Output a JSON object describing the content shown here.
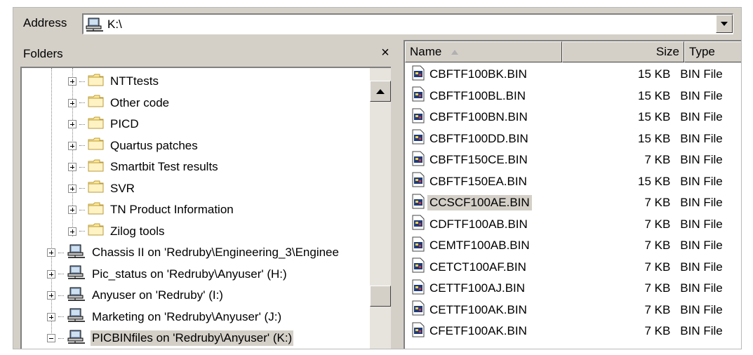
{
  "address": {
    "label": "Address",
    "path": "K:\\"
  },
  "folders": {
    "title": "Folders",
    "close_glyph": "×",
    "items": [
      {
        "label": "NTTtests",
        "icon": "folder-icon",
        "level": 2
      },
      {
        "label": "Other code",
        "icon": "folder-icon",
        "level": 2
      },
      {
        "label": "PICD",
        "icon": "folder-icon",
        "level": 2
      },
      {
        "label": "Quartus patches",
        "icon": "folder-icon",
        "level": 2
      },
      {
        "label": "Smartbit Test results",
        "icon": "folder-icon",
        "level": 2
      },
      {
        "label": "SVR",
        "icon": "folder-icon",
        "level": 2
      },
      {
        "label": "TN Product Information",
        "icon": "folder-icon",
        "level": 2
      },
      {
        "label": "Zilog tools",
        "icon": "folder-icon",
        "level": 2
      },
      {
        "label": "Chassis II on 'Redruby\\Engineering_3\\Enginee",
        "icon": "network-drive-icon",
        "level": 1
      },
      {
        "label": "Pic_status on 'Redruby\\Anyuser' (H:)",
        "icon": "network-drive-icon",
        "level": 1
      },
      {
        "label": "Anyuser on 'Redruby' (I:)",
        "icon": "network-drive-icon",
        "level": 1
      },
      {
        "label": "Marketing on 'Redruby\\Anyuser' (J:)",
        "icon": "network-drive-icon",
        "level": 1
      },
      {
        "label": "PICBINfiles on 'Redruby\\Anyuser' (K:)",
        "icon": "network-drive-icon",
        "level": 1,
        "selected": true,
        "expanded": true
      }
    ]
  },
  "files": {
    "columns": {
      "name": "Name",
      "size": "Size",
      "type": "Type"
    },
    "rows": [
      {
        "name": "CBFTF100BK.BIN",
        "size": "15 KB",
        "type": "BIN File"
      },
      {
        "name": "CBFTF100BL.BIN",
        "size": "15 KB",
        "type": "BIN File"
      },
      {
        "name": "CBFTF100BN.BIN",
        "size": "15 KB",
        "type": "BIN File"
      },
      {
        "name": "CBFTF100DD.BIN",
        "size": "15 KB",
        "type": "BIN File"
      },
      {
        "name": "CBFTF150CE.BIN",
        "size": "7 KB",
        "type": "BIN File"
      },
      {
        "name": "CBFTF150EA.BIN",
        "size": "15 KB",
        "type": "BIN File"
      },
      {
        "name": "CCSCF100AE.BIN",
        "size": "7 KB",
        "type": "BIN File",
        "selected": true
      },
      {
        "name": "CDFTF100AB.BIN",
        "size": "7 KB",
        "type": "BIN File"
      },
      {
        "name": "CEMTF100AB.BIN",
        "size": "7 KB",
        "type": "BIN File"
      },
      {
        "name": "CETCT100AF.BIN",
        "size": "7 KB",
        "type": "BIN File"
      },
      {
        "name": "CETTF100AJ.BIN",
        "size": "7 KB",
        "type": "BIN File"
      },
      {
        "name": "CETTF100AK.BIN",
        "size": "7 KB",
        "type": "BIN File"
      },
      {
        "name": "CFETF100AK.BIN",
        "size": "7 KB",
        "type": "BIN File"
      }
    ]
  },
  "colors": {
    "chrome": "#d4d0c8",
    "folder_fill": "#ffe996",
    "folder_stroke": "#b99b3b",
    "selection": "#d4d0c8"
  }
}
